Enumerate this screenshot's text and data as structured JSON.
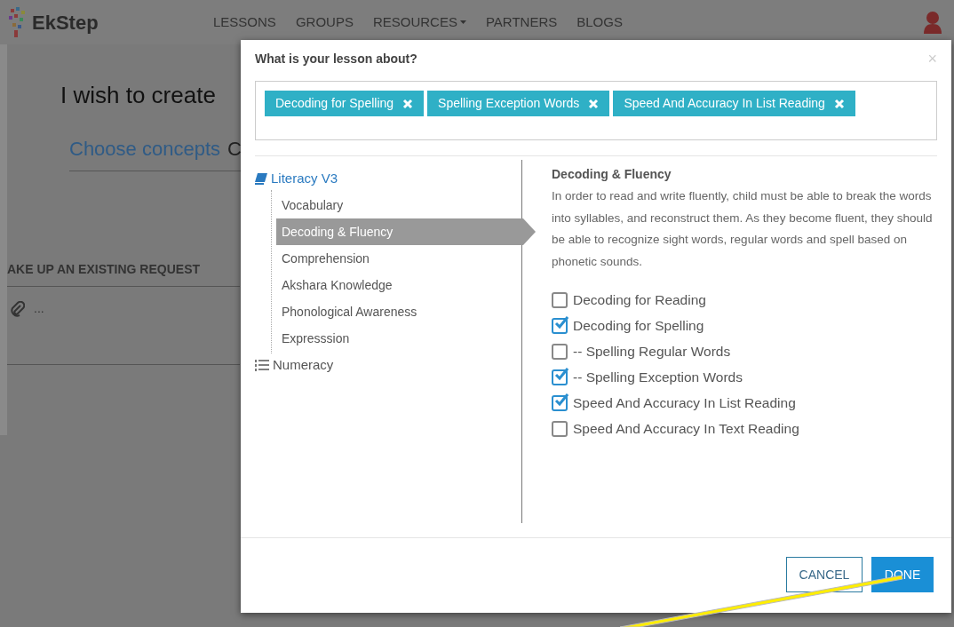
{
  "header": {
    "logo": "EkStep",
    "nav": [
      {
        "label": "LESSONS",
        "has_menu": false
      },
      {
        "label": "GROUPS",
        "has_menu": false
      },
      {
        "label": "RESOURCES",
        "has_menu": true
      },
      {
        "label": "PARTNERS",
        "has_menu": false
      },
      {
        "label": "BLOGS",
        "has_menu": false
      }
    ]
  },
  "page": {
    "heading": "I wish to create",
    "tabs": [
      {
        "label": "Choose concepts",
        "selected": true
      },
      {
        "label": "C",
        "selected": false
      }
    ],
    "section_title": "AKE UP AN EXISTING REQUEST",
    "request_item": "..."
  },
  "modal": {
    "title": "What is your lesson about?",
    "close": "×",
    "tags": [
      {
        "label": "Decoding for Spelling"
      },
      {
        "label": "Spelling Exception Words"
      },
      {
        "label": "Speed And Accuracy In List Reading"
      }
    ],
    "tree": [
      {
        "label": "Literacy V3",
        "expanded": true,
        "children": [
          {
            "label": "Vocabulary",
            "selected": false
          },
          {
            "label": "Decoding & Fluency",
            "selected": true
          },
          {
            "label": "Comprehension",
            "selected": false
          },
          {
            "label": "Akshara Knowledge",
            "selected": false
          },
          {
            "label": "Phonological Awareness",
            "selected": false
          },
          {
            "label": "Expresssion",
            "selected": false
          }
        ]
      },
      {
        "label": "Numeracy",
        "expanded": false
      }
    ],
    "detail": {
      "title": "Decoding & Fluency",
      "description": "In order to read and write fluently, child must be able to break the words into syllables, and reconstruct them. As they become fluent, they should be able to recognize sight words, regular words and spell based on phonetic sounds.",
      "options": [
        {
          "label": "Decoding for Reading",
          "checked": false
        },
        {
          "label": "Decoding for Spelling",
          "checked": true
        },
        {
          "label": "-- Spelling Regular Words",
          "checked": false
        },
        {
          "label": "-- Spelling Exception Words",
          "checked": true
        },
        {
          "label": "Speed And Accuracy In List Reading",
          "checked": true
        },
        {
          "label": "Speed And Accuracy In Text Reading",
          "checked": false
        }
      ]
    },
    "buttons": [
      {
        "label": "CANCEL",
        "kind": "secondary"
      },
      {
        "label": "DONE",
        "kind": "primary"
      }
    ]
  }
}
